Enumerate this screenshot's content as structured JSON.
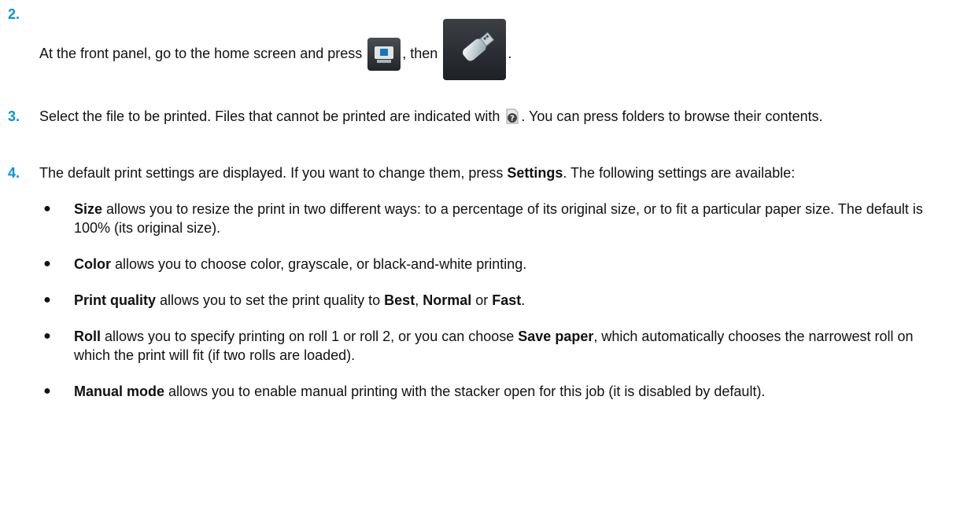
{
  "steps": [
    {
      "number": "2.",
      "text_before": "At the front panel, go to the home screen and press",
      "icon_1": "printer-panel-icon",
      "text_mid": ", then",
      "icon_2": "usb-drive-icon",
      "text_after": "."
    },
    {
      "number": "3.",
      "text_before": "Select the file to be printed. Files that cannot be printed are indicated with",
      "icon": "unprintable-file-icon",
      "text_after": ". You can press folders to browse their contents."
    },
    {
      "number": "4.",
      "text_before": "The default print settings are displayed. If you want to change them, press",
      "bold_settings": "Settings",
      "text_after": ". The following settings are available:",
      "bullets": [
        {
          "term": "Size",
          "text": " allows you to resize the print in two different ways: to a percentage of its original size, or to fit a particular paper size. The default is 100% (its original size)."
        },
        {
          "term": "Color",
          "text": " allows you to choose color, grayscale, or black-and-white printing."
        },
        {
          "term": "Print quality",
          "text_before": " allows you to set the print quality to ",
          "opt1": "Best",
          "sep1": ", ",
          "opt2": "Normal",
          "sep2": " or ",
          "opt3": "Fast",
          "text_after": "."
        },
        {
          "term": "Roll",
          "text_before": " allows you to specify printing on roll 1 or roll 2, or you can choose ",
          "opt": "Save paper",
          "text_after": ", which automatically chooses the narrowest roll on which the print will fit (if two rolls are loaded)."
        },
        {
          "term": "Manual mode",
          "text": " allows you to enable manual printing with the stacker open for this job (it is disabled by default)."
        }
      ]
    }
  ],
  "bullet_char": "●",
  "colors": {
    "step_number": "#0096d6",
    "text": "#111111"
  }
}
